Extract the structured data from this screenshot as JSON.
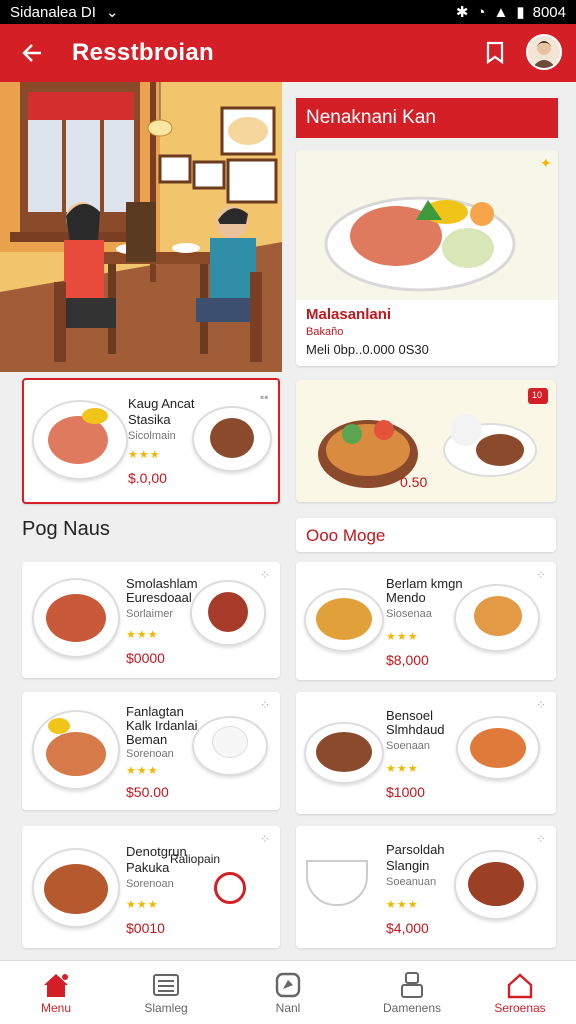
{
  "status_bar": {
    "carrier": "Sidanalea DI",
    "time": "8004"
  },
  "app_bar": {
    "title": "Resstbroian"
  },
  "featured": {
    "header": "Nenaknani Kan",
    "card": {
      "name": "Malasanlani",
      "sub": "Bakaño",
      "price": "Meli 0bp..0.000 0S30"
    }
  },
  "promo_cards": [
    {
      "name": "Kaug Ancat",
      "name2": "Stasika",
      "sub": "Sicolmain",
      "stars": "★★★",
      "price": "$.0,00"
    },
    {
      "price": "0.50",
      "badge": "10"
    }
  ],
  "sections": {
    "left_title": "Pog Naus",
    "right_title": "Ooo Moge"
  },
  "menu_left": [
    {
      "name": "Smolashlam",
      "name2": "Euresdoaal",
      "sub": "Sorlaimer",
      "stars": "★★★",
      "price": "$0000"
    },
    {
      "name": "Fanlagtan",
      "name2": "Kalk Irdanlai",
      "name3": "Beman",
      "sub": "Sorenoan",
      "stars": "★★★",
      "price": "$50.00"
    },
    {
      "name": "Denotgrun",
      "name2": "Pakuka",
      "name3": "Raliopain",
      "sub": "Sorenoan",
      "stars": "★★★",
      "price": "$0010"
    }
  ],
  "menu_right": [
    {
      "name": "Berlam kmgn",
      "name2": "Mendo",
      "sub": "Siosenaa",
      "stars": "★★★",
      "price": "$8,000"
    },
    {
      "name": "Bensoel",
      "name2": "Slmhdaud",
      "sub": "Soenaan",
      "stars": "★★★",
      "price": "$1000"
    },
    {
      "name": "Parsoldah",
      "name2": "Slangin",
      "sub": "Soeanuan",
      "stars": "★★★",
      "price": "$4,000"
    }
  ],
  "bottom_nav": [
    {
      "label": "Menu",
      "icon": "home-icon"
    },
    {
      "label": "Slamleg",
      "icon": "list-icon"
    },
    {
      "label": "Nanl",
      "icon": "compass-icon"
    },
    {
      "label": "Damenens",
      "icon": "person-icon"
    },
    {
      "label": "Seroenas",
      "icon": "house-outline-icon"
    }
  ],
  "colors": {
    "primary": "#d51f27",
    "star": "#f2b600",
    "price": "#c4161c"
  }
}
